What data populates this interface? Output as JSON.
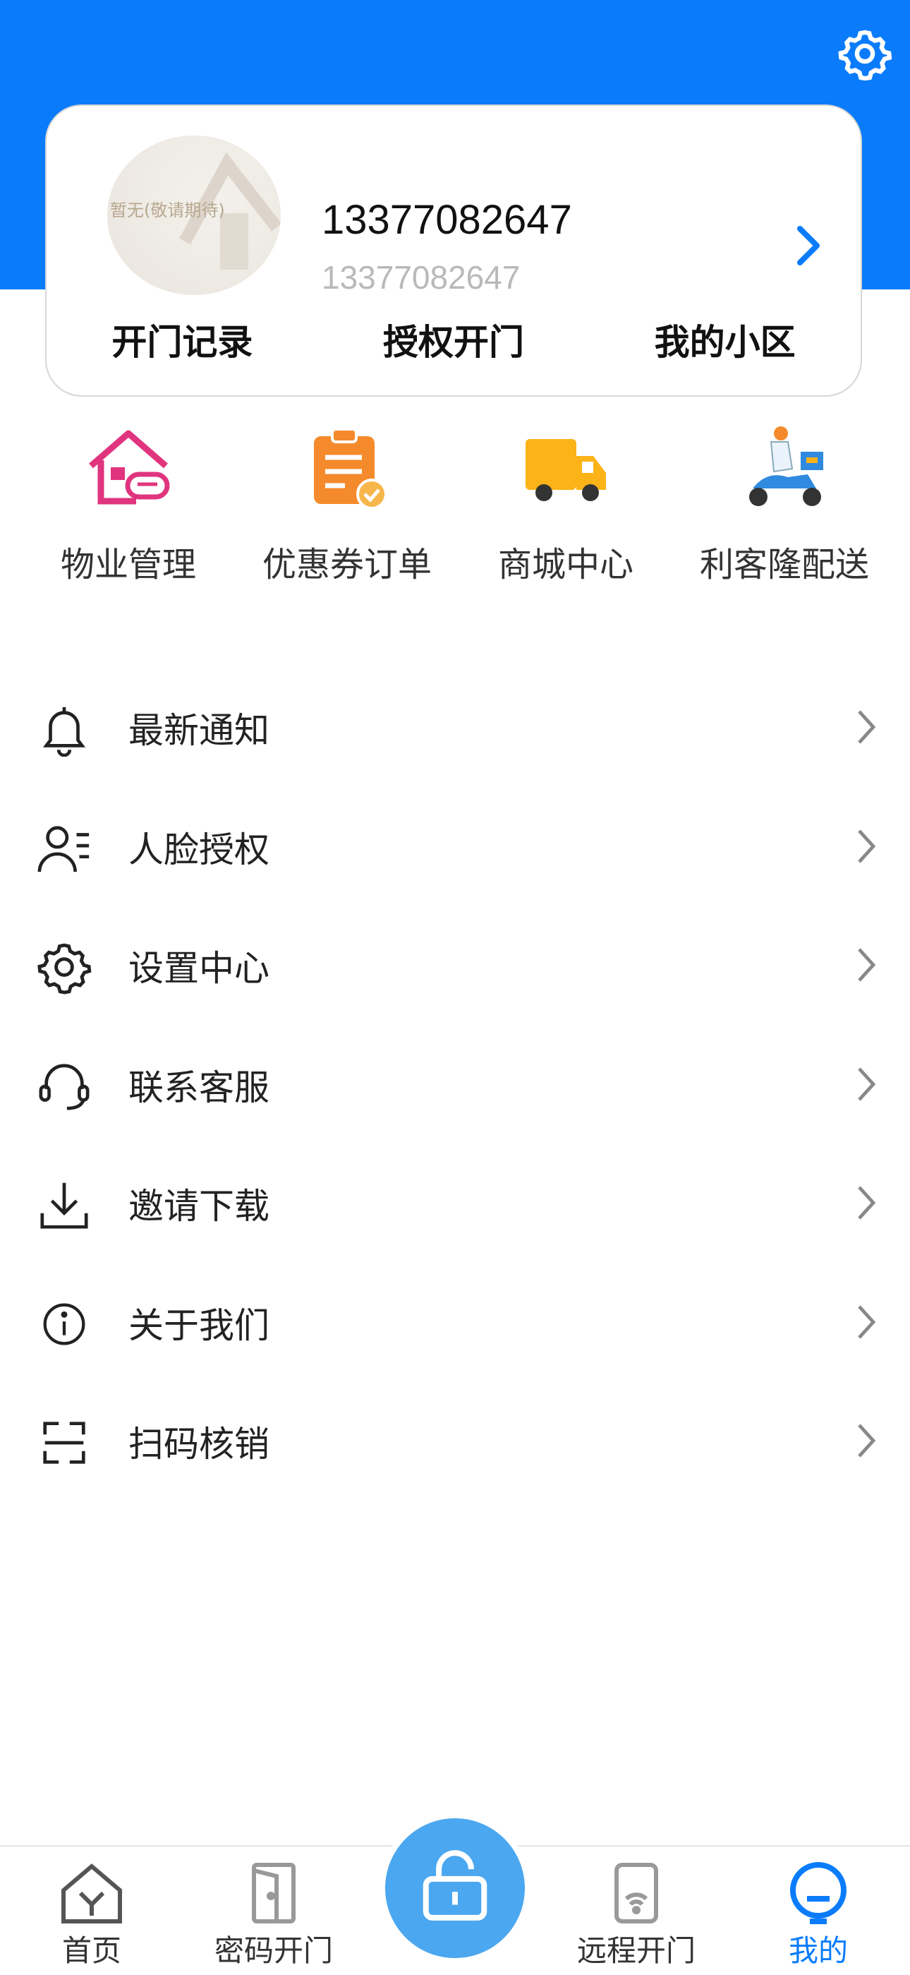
{
  "profile": {
    "avatar_text": "暂无(敬请期待)",
    "phone": "13377082647",
    "account": "13377082647"
  },
  "quick_links": [
    "开门记录",
    "授权开门",
    "我的小区"
  ],
  "services": [
    {
      "label": "物业管理",
      "icon": "property-house-icon"
    },
    {
      "label": "优惠券订单",
      "icon": "coupon-clipboard-icon"
    },
    {
      "label": "商城中心",
      "icon": "delivery-truck-icon"
    },
    {
      "label": "利客隆配送",
      "icon": "scooter-delivery-icon"
    }
  ],
  "menu": [
    {
      "label": "最新通知",
      "icon": "bell-icon"
    },
    {
      "label": "人脸授权",
      "icon": "face-user-icon"
    },
    {
      "label": "设置中心",
      "icon": "gear-icon"
    },
    {
      "label": "联系客服",
      "icon": "headset-icon"
    },
    {
      "label": "邀请下载",
      "icon": "download-icon"
    },
    {
      "label": "关于我们",
      "icon": "info-icon"
    },
    {
      "label": "扫码核销",
      "icon": "scan-icon"
    }
  ],
  "tabbar": {
    "home": "首页",
    "password_open": "密码开门",
    "remote_open": "远程开门",
    "mine": "我的"
  },
  "colors": {
    "brand": "#0a7cfb",
    "center_button": "#4ba7ef"
  }
}
